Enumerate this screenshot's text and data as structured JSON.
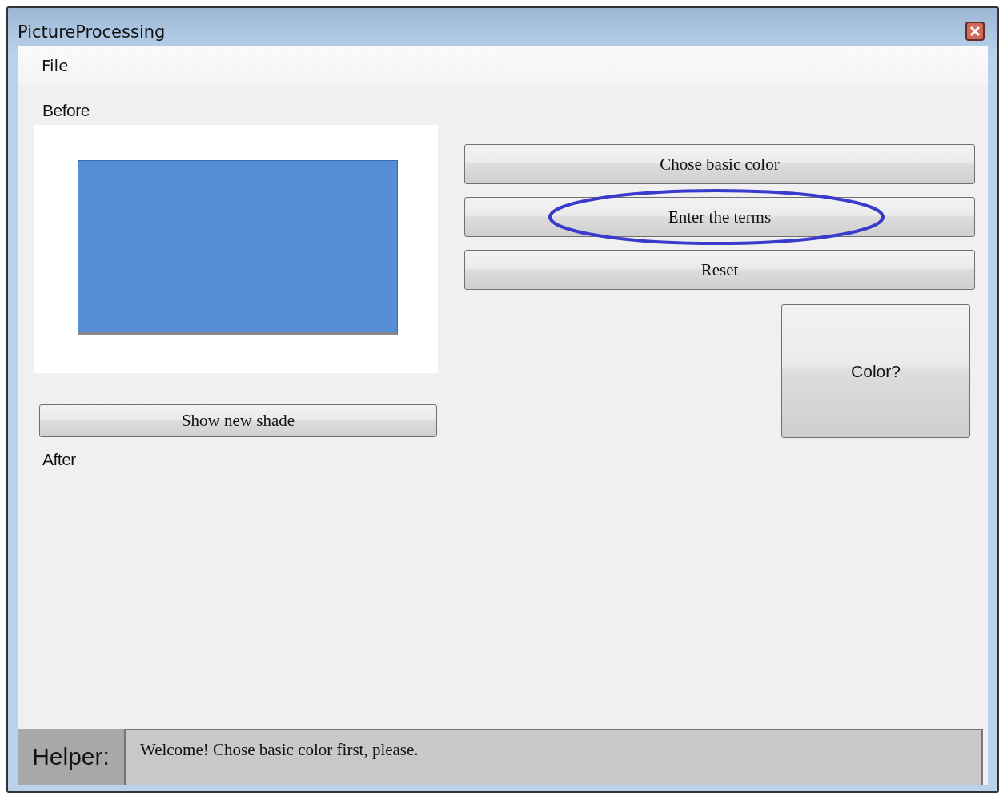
{
  "window": {
    "title": "PictureProcessing"
  },
  "menu": [
    {
      "label": "File"
    }
  ],
  "before": {
    "label": "Before"
  },
  "action_buttons": [
    {
      "label": "Chose basic color",
      "circled": false
    },
    {
      "label": "Enter the terms",
      "circled": true
    },
    {
      "label": "Reset",
      "circled": false
    }
  ],
  "color_button": {
    "label": "Color?"
  },
  "shade_button": {
    "label": "Show new shade"
  },
  "after": {
    "label": "After"
  },
  "helper": {
    "label": "Helper:",
    "message": "Welcome! Chose basic color first, please."
  }
}
